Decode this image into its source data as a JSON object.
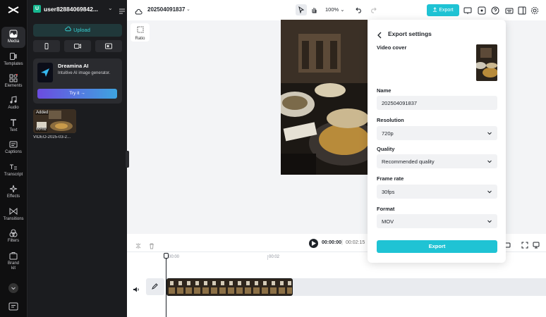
{
  "app": {
    "logo": "capcut-logo"
  },
  "rail": {
    "items": [
      {
        "label": "Media",
        "icon": "media-icon"
      },
      {
        "label": "Templates",
        "icon": "templates-icon"
      },
      {
        "label": "Elements",
        "icon": "elements-icon"
      },
      {
        "label": "Audio",
        "icon": "audio-icon"
      },
      {
        "label": "Text",
        "icon": "text-icon"
      },
      {
        "label": "Captions",
        "icon": "captions-icon"
      },
      {
        "label": "Transcript",
        "icon": "transcript-icon"
      },
      {
        "label": "Effects",
        "icon": "effects-icon"
      },
      {
        "label": "Transitions",
        "icon": "transitions-icon"
      },
      {
        "label": "Filters",
        "icon": "filters-icon"
      },
      {
        "label": "Brand kit",
        "icon": "brand-kit-icon"
      }
    ]
  },
  "panel": {
    "user_initial": "U",
    "user_name": "user82884069842...",
    "upload_label": "Upload",
    "dreamina": {
      "title": "Dreamina AI",
      "subtitle": "Intuitive AI image generator.",
      "button": "Try it →"
    },
    "media_item": {
      "badge": "Added",
      "duration": "00:02",
      "name": "VIDEO-2025-03-2..."
    }
  },
  "topbar": {
    "project_name": "202504091837",
    "zoom": "100%",
    "export_label": "Export"
  },
  "canvas": {
    "ratio_label": "Ratio"
  },
  "timeline": {
    "current_time": "00:00:00",
    "separator": "|",
    "total_time": "00:02:15",
    "ruler": [
      "00:00",
      "00:02"
    ]
  },
  "export_settings": {
    "title": "Export settings",
    "video_cover_label": "Video cover",
    "name_label": "Name",
    "name_value": "202504091837",
    "resolution_label": "Resolution",
    "resolution_value": "720p",
    "quality_label": "Quality",
    "quality_value": "Recommended quality",
    "frame_rate_label": "Frame rate",
    "frame_rate_value": "30fps",
    "format_label": "Format",
    "format_value": "MOV",
    "export_button": "Export"
  },
  "colors": {
    "accent": "#1fc3d4",
    "rail_bg": "#0f0f10",
    "panel_bg": "#1b1c1f"
  }
}
